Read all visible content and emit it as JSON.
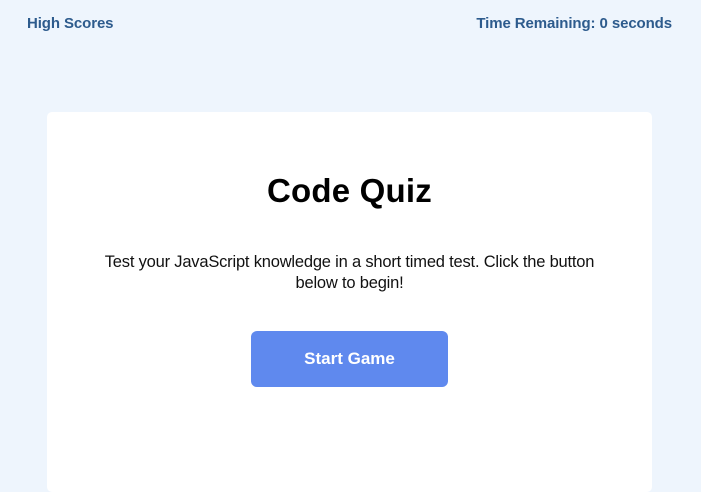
{
  "header": {
    "high_scores_label": "High Scores",
    "time_remaining_label": "Time Remaining: 0 seconds"
  },
  "main": {
    "title": "Code Quiz",
    "description": "Test your JavaScript knowledge in a short timed test. Click the button below to begin!",
    "start_button_label": "Start Game"
  },
  "colors": {
    "page_background": "#eef5fd",
    "card_background": "#ffffff",
    "header_text": "#2d5b8d",
    "button_background": "#5f89ee",
    "button_text": "#ffffff"
  }
}
